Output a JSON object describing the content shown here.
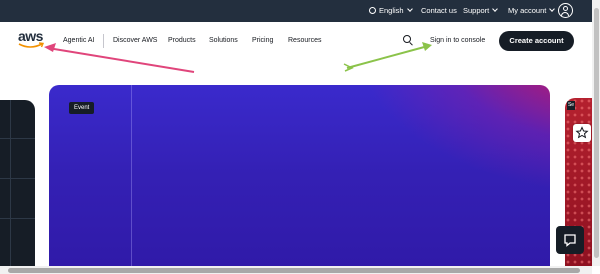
{
  "topbar": {
    "language": "English",
    "contact": "Contact us",
    "support": "Support",
    "account": "My account"
  },
  "nav": {
    "logo_text": "aws",
    "links": [
      "Agentic AI",
      "Discover AWS",
      "Products",
      "Solutions",
      "Pricing",
      "Resources"
    ],
    "signin": "Sign in to console",
    "create_account": "Create account"
  },
  "hero": {
    "badge": "Event"
  },
  "right_card": {
    "badge": "Se"
  },
  "colors": {
    "topbar_bg": "#232f3e",
    "primary_dark": "#161d26",
    "hero_blue": "#3a2acc",
    "hero_red": "#e3154d",
    "annotation_pink": "#e0457b",
    "annotation_green": "#8bc34a"
  },
  "icons": [
    "globe-icon",
    "chevron-down-icon",
    "user-avatar-icon",
    "aws-smile-icon",
    "search-icon",
    "star-icon",
    "chat-icon"
  ]
}
